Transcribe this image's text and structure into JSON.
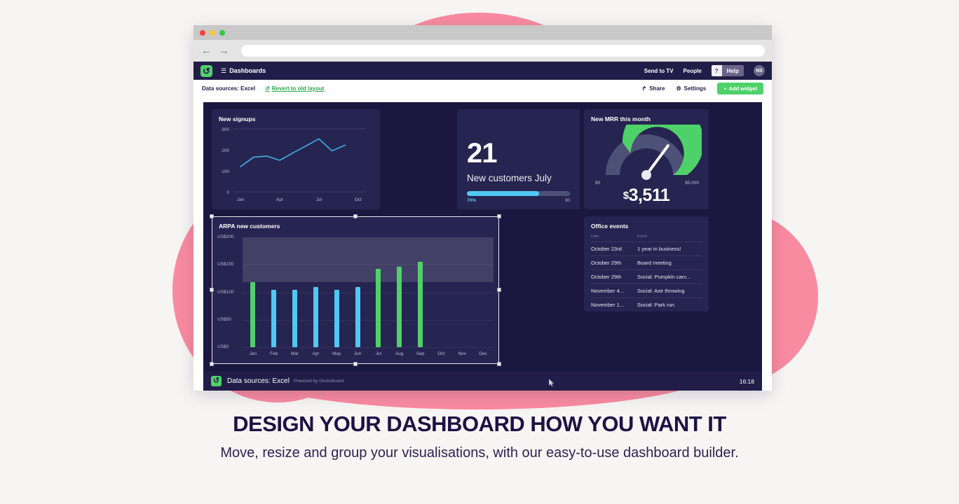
{
  "browser": {
    "traffic_lights": [
      "red",
      "yellow",
      "green"
    ],
    "back_icon": "←",
    "forward_icon": "→",
    "url_value": "",
    "url_placeholder": ""
  },
  "appnav": {
    "logo": "↺",
    "menu_icon": "☰",
    "title": "Dashboards",
    "links": [
      {
        "label": "Send to TV"
      },
      {
        "label": "People"
      }
    ],
    "help_pill": {
      "question": "?",
      "label": "Help"
    },
    "avatar": "NS"
  },
  "subbar": {
    "data_sources": "Data sources: Excel",
    "revert_icon": "↺",
    "revert_label": "Revert to old layout",
    "share_icon": "↱",
    "share_label": "Share",
    "settings_icon": "⚙",
    "settings_label": "Settings",
    "add_icon": "+",
    "add_label": "Add widget"
  },
  "widgets": {
    "signups": {
      "title": "New signups"
    },
    "number": {
      "value": "21",
      "label": "New customers July",
      "progress_percent": 70,
      "progress_left_label": "70%",
      "progress_right_label": "30"
    },
    "gauge": {
      "title": "New MRR this month",
      "min_label": "$0",
      "max_label": "$5,000",
      "currency": "$",
      "value_label": "3,511",
      "min": 0,
      "max": 5000,
      "value": 3511
    },
    "arpa": {
      "title": "ARPA new customers"
    },
    "events": {
      "title": "Office events",
      "columns": [
        "Date",
        "Event"
      ],
      "rows": [
        {
          "date": "October 23rd",
          "event": "1 year in business!"
        },
        {
          "date": "October 29th",
          "event": "Board meeting"
        },
        {
          "date": "October 29th",
          "event": "Social: Pumpkin carv..."
        },
        {
          "date": "November 4...",
          "event": "Social: Axe throwing"
        },
        {
          "date": "November 1...",
          "event": "Social: Park run"
        }
      ]
    }
  },
  "board_footer": {
    "logo": "↺",
    "data_sources": "Data sources: Excel",
    "powered_by": "Powered by Geckoboard",
    "time": "16:18"
  },
  "caption": {
    "headline": "DESIGN YOUR DASHBOARD HOW YOU WANT IT",
    "subline": "Move, resize and group your visualisations, with our easy-to-use dashboard builder."
  },
  "colors": {
    "brand_green": "#4fd16a",
    "accent_blue": "#50c8f2",
    "dark_navy": "#221c48",
    "board_bg": "#1a1840",
    "widget_bg": "#262450",
    "pink": "#f98ba0"
  },
  "chart_data": [
    {
      "type": "line",
      "title": "New signups",
      "xlabel": "",
      "ylabel": "",
      "ylim": [
        0,
        300
      ],
      "yticks": [
        0,
        100,
        200,
        300
      ],
      "ytick_labels": [
        "0",
        "100",
        "200",
        "300"
      ],
      "x": [
        "Jan",
        "Feb",
        "Mar",
        "Apr",
        "May",
        "Jun",
        "Jul",
        "Aug",
        "Sep"
      ],
      "xtick_labels": [
        "Jan",
        "Apr",
        "Jul",
        "Oct"
      ],
      "values": [
        120,
        165,
        170,
        150,
        185,
        218,
        252,
        195,
        222
      ],
      "line_color": "#3fa9dd",
      "grid": true,
      "legend": "none"
    },
    {
      "type": "bar",
      "title": "ARPA new customers",
      "xlabel": "",
      "ylabel": "",
      "ylim": [
        0,
        200
      ],
      "yticks": [
        0,
        50,
        100,
        150,
        200
      ],
      "ytick_labels": [
        "US$0",
        "US$50",
        "US$100",
        "US$150",
        "US$200"
      ],
      "categories": [
        "Jan",
        "Feb",
        "Mar",
        "Apr",
        "May",
        "Jun",
        "Jul",
        "Aug",
        "Sep",
        "Oct",
        "Nov",
        "Dec"
      ],
      "values": [
        118,
        105,
        105,
        110,
        104,
        110,
        143,
        146,
        155,
        null,
        null,
        null
      ],
      "bar_colors": [
        "#4fd16a",
        "#50c8f2",
        "#50c8f2",
        "#50c8f2",
        "#50c8f2",
        "#50c8f2",
        "#4fd16a",
        "#4fd16a",
        "#4fd16a",
        null,
        null,
        null
      ],
      "highlight_band": [
        118,
        200
      ],
      "grid": true,
      "legend": "none",
      "selected": true
    },
    {
      "type": "gauge",
      "title": "New MRR this month",
      "min": 0,
      "max": 5000,
      "value": 3511,
      "min_label": "$0",
      "max_label": "$5,000",
      "value_label": "$3,511",
      "arc_color": "#4fd16a",
      "track_color": "#4d5178"
    }
  ]
}
